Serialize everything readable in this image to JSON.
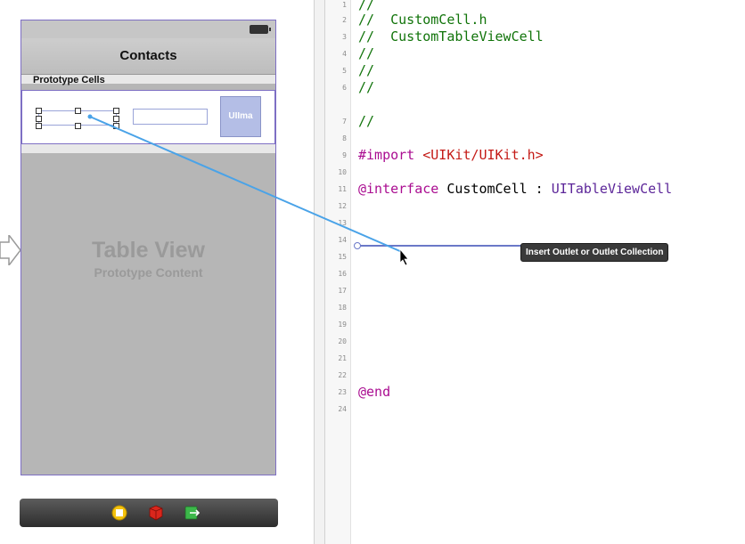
{
  "storyboard": {
    "scene": {
      "nav_title": "Contacts",
      "section_label": "Prototype Cells",
      "cell": {
        "image_label": "UIIma"
      },
      "placeholder_title": "Table View",
      "placeholder_subtitle": "Prototype Content"
    },
    "dock": {
      "icons": [
        "view-controller-icon",
        "first-responder-icon",
        "exit-icon"
      ]
    }
  },
  "editor": {
    "lines": [
      {
        "n": "1",
        "parts": [
          {
            "t": "//",
            "c": "cm"
          }
        ]
      },
      {
        "n": "2",
        "parts": [
          {
            "t": "//  CustomCell.h",
            "c": "cm"
          }
        ]
      },
      {
        "n": "3",
        "parts": [
          {
            "t": "//  CustomTableViewCell",
            "c": "cm"
          }
        ]
      },
      {
        "n": "4",
        "parts": [
          {
            "t": "//",
            "c": "cm"
          }
        ]
      },
      {
        "n": "5",
        "parts": [
          {
            "t": "//",
            "c": "cm"
          }
        ]
      },
      {
        "n": "6",
        "parts": [
          {
            "t": "//",
            "c": "cm"
          }
        ]
      },
      {
        "n": "7",
        "parts": [
          {
            "t": "//",
            "c": "cm"
          }
        ]
      },
      {
        "n": "8",
        "parts": []
      },
      {
        "n": "9",
        "parts": [
          {
            "t": "#import ",
            "c": "kw"
          },
          {
            "t": "<UIKit/UIKit.h>",
            "c": "str"
          }
        ]
      },
      {
        "n": "10",
        "parts": []
      },
      {
        "n": "11",
        "parts": [
          {
            "t": "@interface",
            "c": "kw"
          },
          {
            "t": " CustomCell : ",
            "c": "pl"
          },
          {
            "t": "UITableViewCell",
            "c": "tp"
          }
        ]
      },
      {
        "n": "12",
        "parts": []
      },
      {
        "n": "13",
        "parts": []
      },
      {
        "n": "14",
        "parts": []
      },
      {
        "n": "15",
        "parts": []
      },
      {
        "n": "16",
        "parts": []
      },
      {
        "n": "17",
        "parts": []
      },
      {
        "n": "18",
        "parts": []
      },
      {
        "n": "19",
        "parts": []
      },
      {
        "n": "20",
        "parts": []
      },
      {
        "n": "21",
        "parts": []
      },
      {
        "n": "22",
        "parts": []
      },
      {
        "n": "23",
        "parts": [
          {
            "t": "@end",
            "c": "kw"
          }
        ]
      },
      {
        "n": "24",
        "parts": []
      }
    ],
    "tooltip": "Insert Outlet or Outlet Collection"
  },
  "colors": {
    "comment": "#11740a",
    "keyword": "#aa0d91",
    "string": "#c41a16",
    "type": "#5c2699",
    "connection_line": "#4aa3e8",
    "selection": "#7e6fc4"
  }
}
